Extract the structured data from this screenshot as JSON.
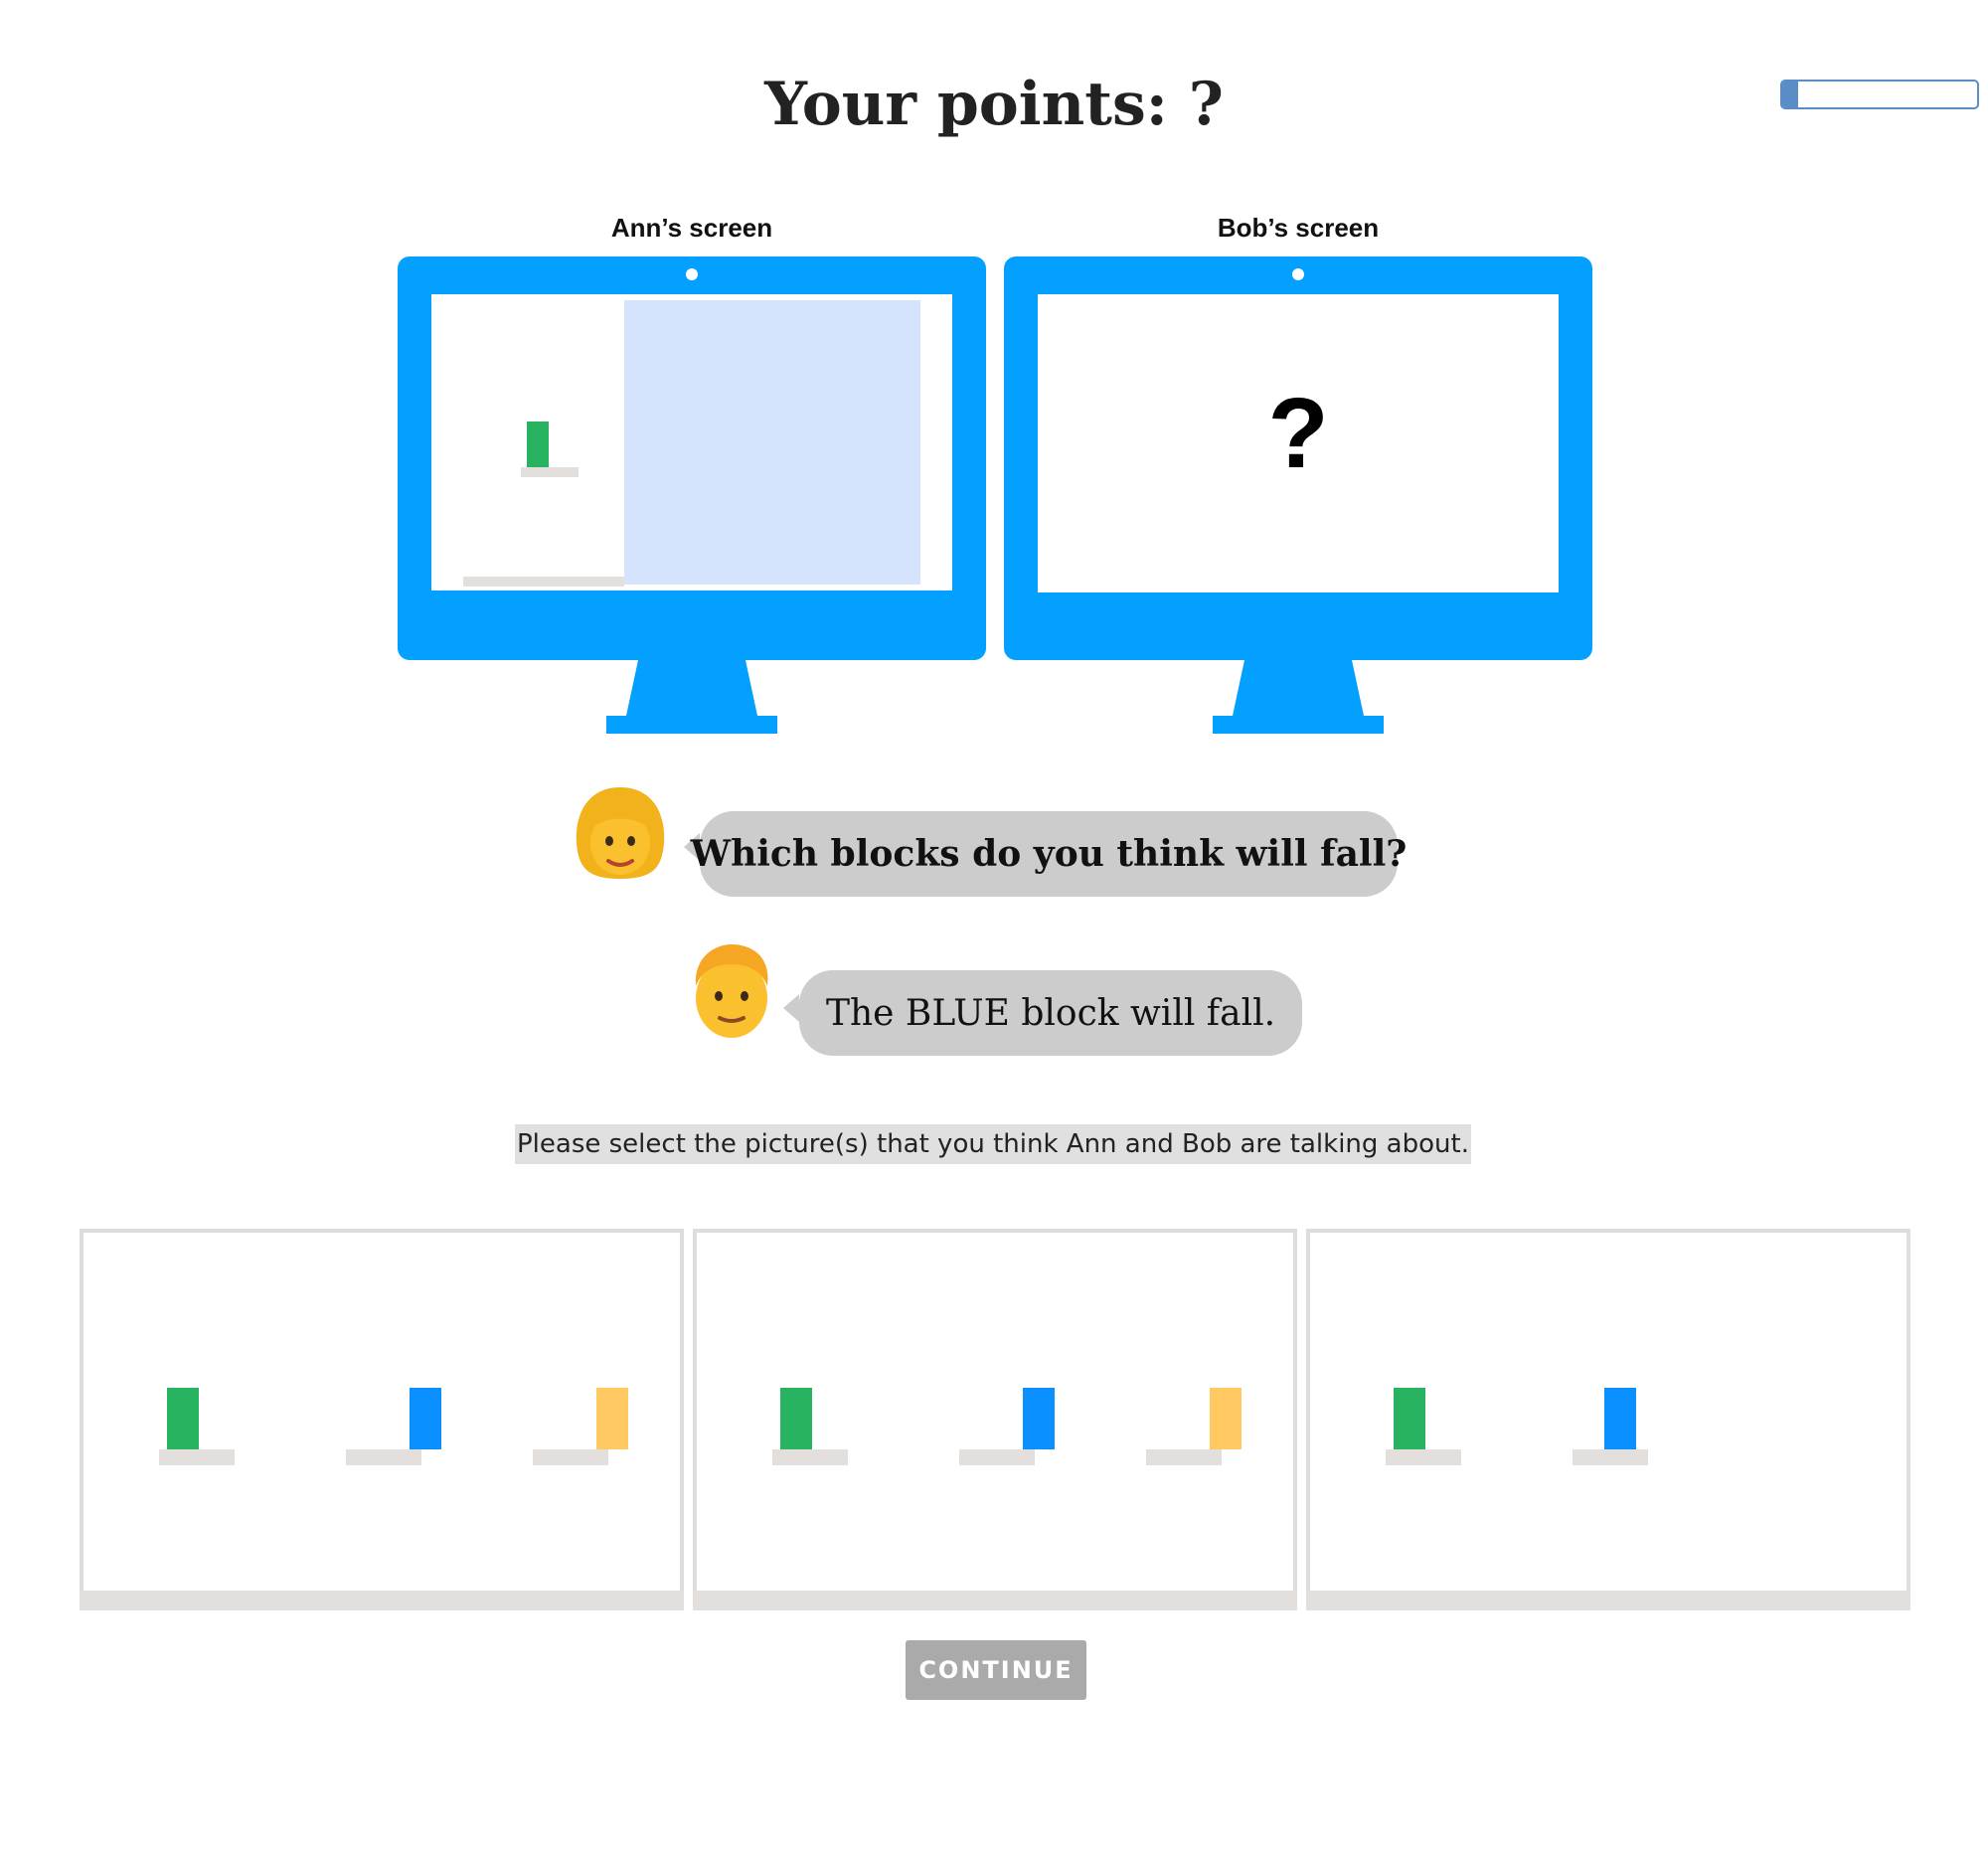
{
  "header": {
    "points_title": "Your points: ?",
    "progress_fraction": 0.08
  },
  "screens": {
    "ann_label": "Ann’s screen",
    "bob_label": "Bob’s screen",
    "bob_hidden": "?"
  },
  "colors": {
    "monitor": "#03a0ff",
    "green_block": "#27b35f",
    "blue_block": "#0a90ff",
    "yellow_block": "#ffc861",
    "occluder": "#d6e3fd",
    "shelf": "#e2dfdc",
    "bubble": "#cccccc"
  },
  "chat": [
    {
      "speaker": "Ann",
      "avatar": "woman-emoji",
      "text": "Which blocks do you think will fall?"
    },
    {
      "speaker": "Bob",
      "avatar": "man-emoji",
      "text": "The BLUE block will fall."
    }
  ],
  "instruction": "Please select the picture(s) that you think Ann and Bob are talking about.",
  "choices": [
    {
      "blocks": [
        "green",
        "blue",
        "yellow"
      ]
    },
    {
      "blocks": [
        "green",
        "blue",
        "yellow"
      ]
    },
    {
      "blocks": [
        "green",
        "blue"
      ]
    }
  ],
  "continue_label": "CONTINUE"
}
